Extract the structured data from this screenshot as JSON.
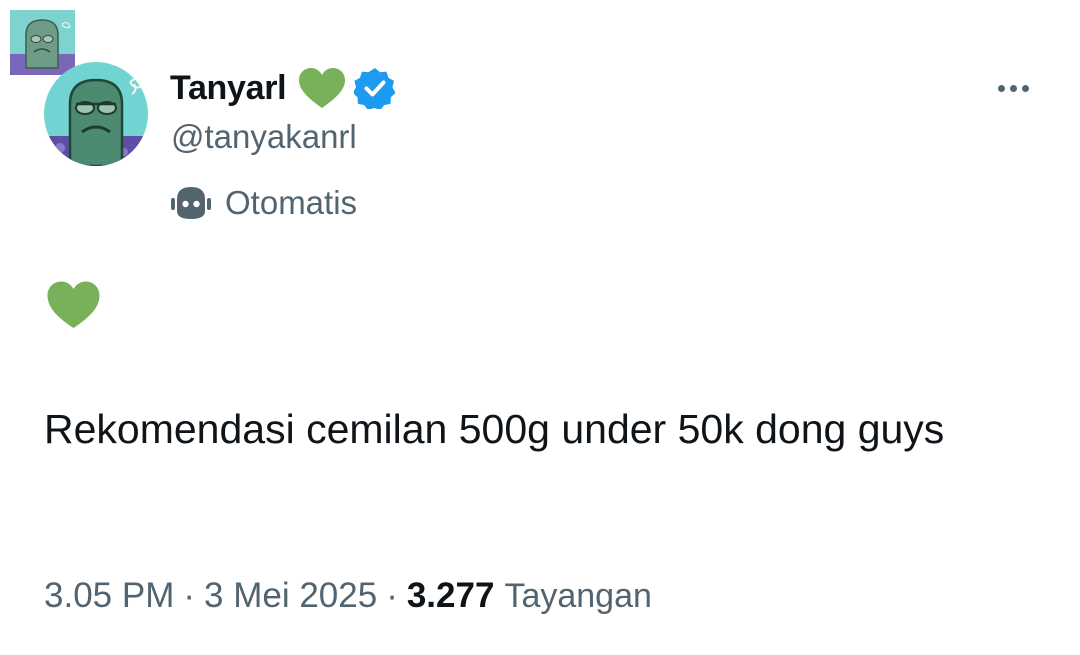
{
  "colors": {
    "heart_green": "#78b159",
    "verified_blue": "#1d9bf0",
    "secondary_text": "#536471",
    "primary_text": "#0f1419"
  },
  "author": {
    "display_name": "Tanyarl",
    "name_emoji": "green-heart-icon",
    "verified_badge": "verified-badge-icon",
    "handle": "@tanyakanrl",
    "automated_icon": "robot-icon",
    "automated_label": "Otomatis"
  },
  "tweet": {
    "emoji_line": "green-heart-icon",
    "text": "Rekomendasi cemilan 500g under 50k dong guys"
  },
  "meta": {
    "time": "3.05 PM",
    "separator": "·",
    "date": "3 Mei 2025",
    "views_count": "3.277",
    "views_label": "Tayangan"
  },
  "actions": {
    "more_icon": "more-horizontal-icon"
  }
}
